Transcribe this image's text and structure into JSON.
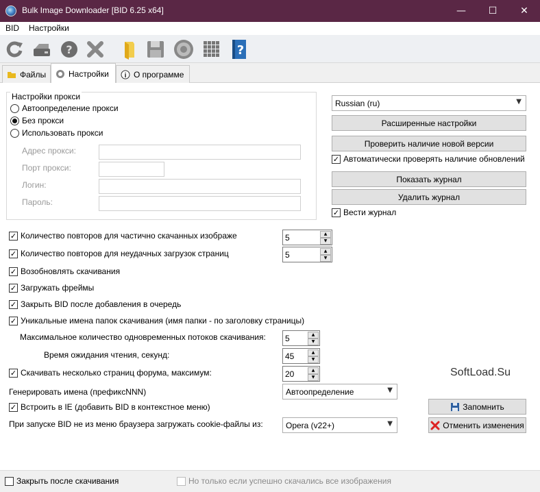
{
  "window": {
    "title": "Bulk Image Downloader [BID 6.25 x64]",
    "controls": {
      "minimize": "—",
      "maximize": "☐",
      "close": "✕"
    }
  },
  "menu": [
    "BID",
    "Настройки"
  ],
  "toolbar": [
    "refresh-icon",
    "hard-drive-icon",
    "help-icon",
    "delete-icon",
    "folder-icon",
    "save-icon",
    "gear-icon",
    "grid-icon",
    "book-help-icon"
  ],
  "tabs": [
    {
      "label": "Файлы",
      "icon": "folder-icon"
    },
    {
      "label": "Настройки",
      "icon": "gear-icon"
    },
    {
      "label": "О программе",
      "icon": "info-icon"
    }
  ],
  "proxy": {
    "group_label": "Настройки прокси",
    "options": [
      "Автоопределение прокси",
      "Без прокси",
      "Использовать прокси"
    ],
    "selected": 1,
    "fields": {
      "address_label": "Адрес прокси:",
      "port_label": "Порт прокси:",
      "login_label": "Логин:",
      "password_label": "Пароль:"
    }
  },
  "right": {
    "language": "Russian (ru)",
    "advanced_button": "Расширенные настройки",
    "check_version_button": "Проверить наличие новой версии",
    "auto_check_label": "Автоматически проверять наличие обновлений",
    "show_log_button": "Показать журнал",
    "delete_log_button": "Удалить журнал",
    "keep_log_label": "Вести журнал"
  },
  "options": {
    "retries_partial_label": "Количество повторов для частично скачанных изображе",
    "retries_partial_value": "5",
    "retries_failed_label": "Количество повторов для неудачных загрузок страниц",
    "retries_failed_value": "5",
    "resume_label": "Возобновлять скачивания",
    "load_frames_label": "Загружать фреймы",
    "close_after_queue_label": "Закрыть BID после добавления в очередь",
    "unique_folders_label": "Уникальные имена папок скачивания (имя папки - по заголовку страницы)",
    "max_threads_label": "Максимальное количество одновременных потоков скачивания:",
    "max_threads_value": "5",
    "read_timeout_label": "Время ожидания чтения, секунд:",
    "read_timeout_value": "45",
    "forum_pages_label": "Скачивать несколько страниц форума, максимум:",
    "forum_pages_value": "20",
    "generate_names_label": "Генерировать имена (префиксNNN)",
    "generate_names_value": "Автоопределение",
    "ie_integration_label": "Встроить в IE (добавить BID в контекстное меню)",
    "cookies_label": "При запуске BID не из меню браузера загружать cookie-файлы из:",
    "cookies_value": "Opera (v22+)",
    "save_button": "Запомнить",
    "cancel_button": "Отменить изменения"
  },
  "watermark": "SoftLoad.Su",
  "status": {
    "close_after_download_label": "Закрыть после скачивания",
    "only_if_success_label": "Но только если успешно скачались все изображения"
  }
}
